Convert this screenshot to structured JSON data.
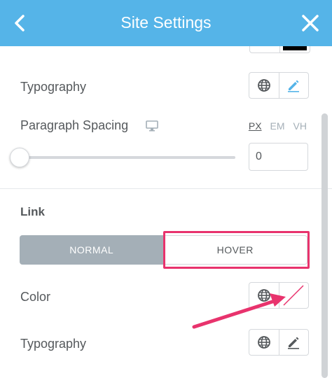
{
  "header": {
    "title": "Site Settings"
  },
  "body_typography": {
    "label": "Typography"
  },
  "paragraph_spacing": {
    "label": "Paragraph Spacing",
    "units": [
      "PX",
      "EM",
      "VH"
    ],
    "active_unit": "PX",
    "value": "0"
  },
  "link": {
    "section_title": "Link",
    "tabs": {
      "normal": "NORMAL",
      "hover": "HOVER"
    },
    "color_label": "Color",
    "typography_label": "Typography"
  },
  "colors": {
    "header_bg": "#55b4e8",
    "tab_active_bg": "#a4afb7",
    "highlight": "#e8336d",
    "pencil_active": "#55b4e8"
  },
  "icons": {
    "back": "chevron-left-icon",
    "close": "close-icon",
    "globe": "globe-icon",
    "pencil": "pencil-icon",
    "monitor": "desktop-icon",
    "no_color": "no-color-swatch"
  }
}
